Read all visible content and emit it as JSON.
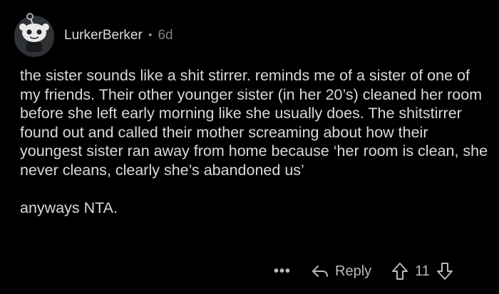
{
  "comment": {
    "username": "LurkerBerker",
    "separator": "•",
    "age": "6d",
    "paragraphs": [
      "the sister sounds like a shit stirrer. reminds me of a sister of one of my friends. Their other younger sister (in her 20’s) cleaned her room before she left early morning like she usually does. The shitstirrer found out and called their mother screaming about how their youngest sister ran away from home because ‘her room is clean, she never cleans, clearly she’s abandoned us’",
      "anyways NTA."
    ]
  },
  "actions": {
    "more_label": "•••",
    "reply_label": "Reply",
    "vote_count": "11"
  },
  "icons": [
    "avatar",
    "more-icon",
    "reply-icon",
    "upvote-icon",
    "downvote-icon"
  ],
  "colors": {
    "background": "#000000",
    "text": "#d7dadc",
    "muted": "#818384"
  }
}
